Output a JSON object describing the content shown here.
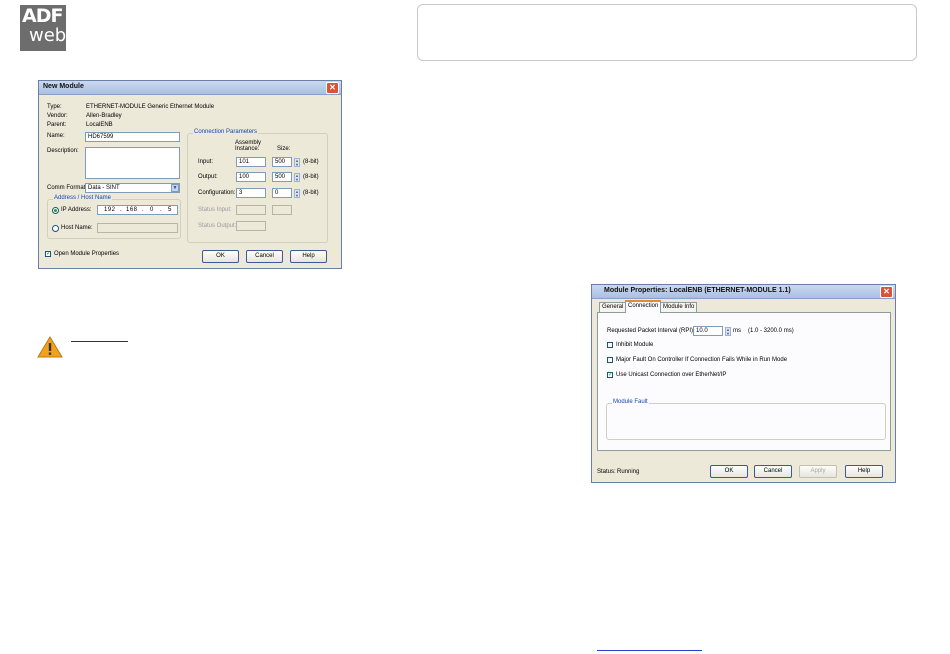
{
  "logo": {
    "line1": "ADF",
    "line2": "web"
  },
  "new_module": {
    "title": "New Module",
    "type_label": "Type:",
    "type_value": "ETHERNET-MODULE Generic Ethernet Module",
    "vendor_label": "Vendor:",
    "vendor_value": "Allen-Bradley",
    "parent_label": "Parent:",
    "parent_value": "LocalENB",
    "name_label": "Name:",
    "name_value": "HD67599",
    "description_label": "Description:",
    "description_value": "",
    "comm_format_label": "Comm Format:",
    "comm_format_value": "Data - SINT",
    "address_group": "Address / Host Name",
    "ip_label": "IP Address:",
    "ip": [
      "192",
      "168",
      "0",
      "5"
    ],
    "host_label": "Host Name:",
    "host_value": "",
    "conn_group": "Connection Parameters",
    "col_assembly": "Assembly Instance:",
    "col_size": "Size:",
    "rows": [
      {
        "label": "Input:",
        "instance": "101",
        "size": "500",
        "unit": "(8-bit)"
      },
      {
        "label": "Output:",
        "instance": "100",
        "size": "500",
        "unit": "(8-bit)"
      },
      {
        "label": "Configuration:",
        "instance": "3",
        "size": "0",
        "unit": "(8-bit)"
      }
    ],
    "status_input_label": "Status Input:",
    "status_output_label": "Status Output:",
    "open_props_label": "Open Module Properties",
    "open_props_checked": true,
    "ok": "OK",
    "cancel": "Cancel",
    "help": "Help"
  },
  "module_props": {
    "title": "Module Properties: LocalENB (ETHERNET-MODULE 1.1)",
    "tabs": [
      "General",
      "Connection",
      "Module Info"
    ],
    "active_tab": "Connection",
    "rpi_label": "Requested Packet Interval (RPI):",
    "rpi_value": "10.0",
    "rpi_unit": "ms",
    "rpi_range": "(1.0 - 3200.0 ms)",
    "inhibit_label": "Inhibit Module",
    "inhibit_checked": false,
    "major_fault_label": "Major Fault On Controller If Connection Fails While in Run Mode",
    "major_fault_checked": false,
    "unicast_label": "Use Unicast Connection over EtherNet/IP",
    "unicast_checked": true,
    "module_fault_group": "Module Fault",
    "status_label": "Status:",
    "status_value": "Running",
    "ok": "OK",
    "cancel": "Cancel",
    "apply": "Apply",
    "help": "Help"
  },
  "colors": {
    "accent_tab": "#e68b2c",
    "warning": "#f0a21c",
    "link": "#2b3fcf"
  },
  "icons": [
    "warning-icon",
    "close-icon",
    "spinner-icon",
    "dropdown-arrow-icon"
  ]
}
